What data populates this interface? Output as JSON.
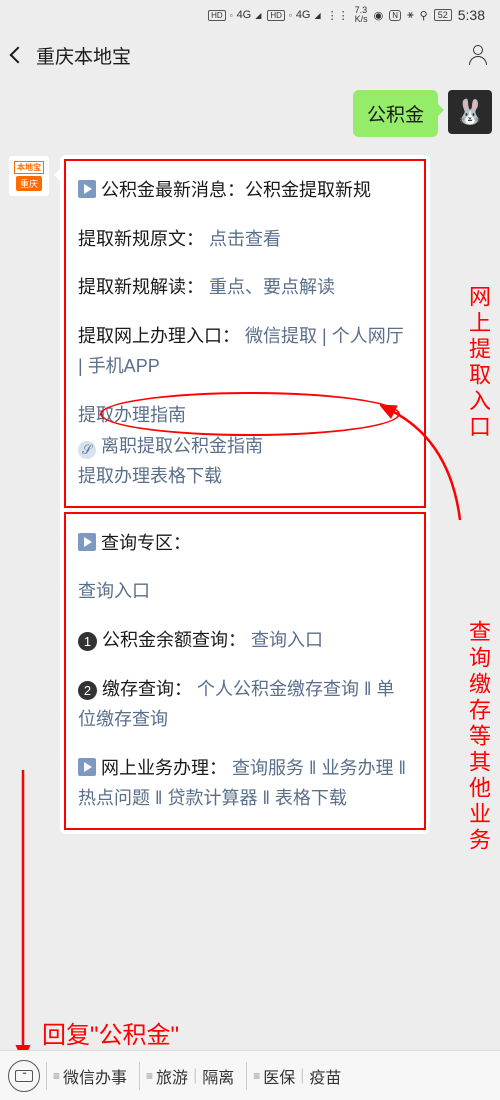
{
  "status": {
    "speed": "7.3",
    "speed_unit": "K/s",
    "battery": "52",
    "time": "5:38",
    "sig": "4G"
  },
  "nav": {
    "title": "重庆本地宝"
  },
  "outgoing": {
    "text": "公积金"
  },
  "bot_avatar": {
    "top": "本地宝",
    "sub": "重庆"
  },
  "card1": {
    "sec1_prefix": "公积金最新消息：公积金提取新规",
    "sec2_label": "提取新规原文：",
    "sec2_link": "点击查看",
    "sec3_label": "提取新规解读：",
    "sec3_link": "重点、要点解读",
    "sec4_label": "提取网上办理入口：",
    "sec4_l1": "微信提取",
    "sec4_l2": "个人网厅",
    "sec4_l3": "手机APP",
    "sec5_title": "提取办理指南",
    "sec5_link": "离职提取公积金指南",
    "sec5_dl": "提取办理表格下载"
  },
  "card2": {
    "title": "查询专区：",
    "entry": "查询入口",
    "q1_label": "公积金余额查询：",
    "q1_link": "查询入口",
    "q2_label": "缴存查询：",
    "q2_l1": "个人公积金缴存查询",
    "q2_l2": "单位缴存查询",
    "q3_label": "网上业务办理：",
    "q3_l1": "查询服务",
    "q3_l2": "业务办理",
    "q3_l3": "热点问题",
    "q3_l4": "贷款计算器",
    "q3_l5": "表格下载"
  },
  "annotations": {
    "right1": "网上提取入口",
    "right2": "查询缴存等其他业务",
    "reply": "回复\"公积金\""
  },
  "menu": {
    "m1": "微信办事",
    "m2": "旅游",
    "m3": "隔离",
    "m4": "医保",
    "m5": "疫苗"
  }
}
